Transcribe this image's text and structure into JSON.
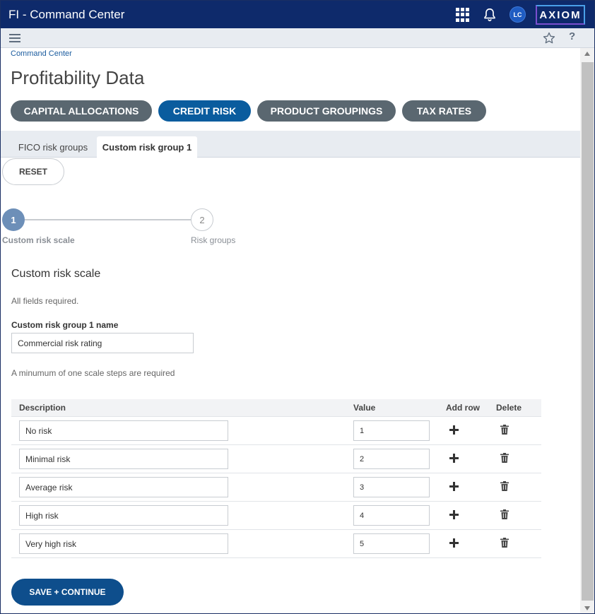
{
  "header": {
    "app_title": "FI - Command Center",
    "avatar_initials": "LC",
    "logo_text": "AXIOM",
    "brand_color": "#0e2a6b"
  },
  "toolbar": {
    "help_label": "?"
  },
  "breadcrumb": "Command Center",
  "page_title": "Profitability Data",
  "category_buttons": [
    {
      "label": "CAPITAL ALLOCATIONS",
      "active": false
    },
    {
      "label": "CREDIT RISK",
      "active": true
    },
    {
      "label": "PRODUCT GROUPINGS",
      "active": false
    },
    {
      "label": "TAX RATES",
      "active": false
    }
  ],
  "tabs": [
    {
      "label": "FICO risk groups",
      "active": false
    },
    {
      "label": "Custom risk group 1",
      "active": true
    }
  ],
  "reset_label": "RESET",
  "stepper": {
    "steps": [
      {
        "number": "1",
        "label": "Custom risk scale",
        "active": true
      },
      {
        "number": "2",
        "label": "Risk groups",
        "active": false
      }
    ]
  },
  "form": {
    "section_title": "Custom risk scale",
    "required_note": "All fields required.",
    "name_label": "Custom risk group 1 name",
    "name_value": "Commercial risk rating",
    "steps_note": "A minumum of one scale steps are required"
  },
  "table": {
    "headers": {
      "description": "Description",
      "value": "Value",
      "add_row": "Add row",
      "delete": "Delete"
    },
    "rows": [
      {
        "description": "No risk",
        "value": "1"
      },
      {
        "description": "Minimal risk",
        "value": "2"
      },
      {
        "description": "Average risk",
        "value": "3"
      },
      {
        "description": "High risk",
        "value": "4"
      },
      {
        "description": "Very high risk",
        "value": "5"
      }
    ]
  },
  "save_label": "SAVE + CONTINUE"
}
